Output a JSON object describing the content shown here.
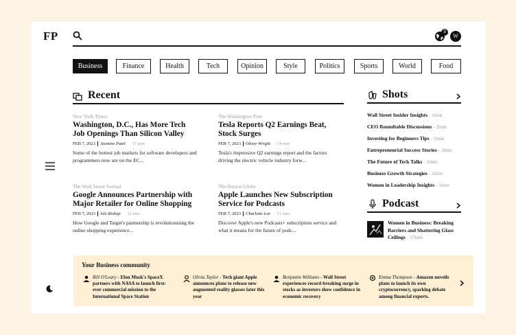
{
  "header": {
    "logo": "FP",
    "notification_count": "3",
    "avatar_initial": "W"
  },
  "categories": [
    "Business",
    "Finance",
    "Health",
    "Tech",
    "Opinion",
    "Style",
    "Politics",
    "Sports",
    "World",
    "Food"
  ],
  "active_category": "Business",
  "recent": {
    "title": "Recent",
    "articles": [
      {
        "source": "New York Times",
        "headline": "Washington, D.C., Has More Tech Job Openings Than Silicon Valley",
        "date": "FEB 7, 2023",
        "author": "Jasmine Patel",
        "read": "17 min",
        "excerpt": "Some of the hottest job markets for software developers and programmers now are on the EC..."
      },
      {
        "source": "The Washington Post",
        "headline": "Tesla Reports Q2 Earnings Beat, Stock Surges",
        "date": "FEB 7, 2023",
        "author": "Oliver Wright",
        "read": "14 min",
        "excerpt": "Tesla's impressive Q2 earnings report and the factors driving the electric vehicle industry forw..."
      },
      {
        "source": "The Wall Street Journal",
        "headline": "Google Announces Partnership with Major Retailer for Online Shopping",
        "date": "FEB 7, 2023",
        "author": "Isla Bishop",
        "read": "12 min",
        "excerpt": "How Google and Target's partnership is revolutionising the online shopping experience..."
      },
      {
        "source": "The Boston Globe",
        "headline": "Apple Launches New Subscription Service for Podcasts",
        "date": "FEB 7, 2023",
        "author": "Charlotte Lee",
        "read": "11 min",
        "excerpt": "Discover Apple's new Podcasts+ subscription service and what it means for the future of podc..."
      }
    ]
  },
  "shots": {
    "title": "Shots",
    "items": [
      {
        "title": "Wall Street Insider Insights",
        "time": "1min"
      },
      {
        "title": "CEO Roundtable Discussions",
        "time": "2min"
      },
      {
        "title": "Investing for Beginners Tips",
        "time": "1min"
      },
      {
        "title": "Entrepreneurial Success Stories",
        "time": "3min"
      },
      {
        "title": "The Future of Tech Talks",
        "time": "2min"
      },
      {
        "title": "Business Growth Strategies",
        "time": "1min"
      },
      {
        "title": "Women in Leadership Insights",
        "time": "1min"
      }
    ]
  },
  "podcast": {
    "title": "Podcast",
    "item": {
      "title": "Women in Business: Breaking Barriers and Shattering Glass Ceilings",
      "time": "37min"
    }
  },
  "community": {
    "title": "Your Business community",
    "posts": [
      {
        "name": "Bill O'Leary",
        "text": "Elon Musk's SpaceX partners with NASA to launch first-ever commercial mission to the International Space Station"
      },
      {
        "name": "Olivia Taylor",
        "text": "Tech giant Apple announces plans to release new augmented reality glasses later this year"
      },
      {
        "name": "Benjamin Williams",
        "text": "Wall Street experiences record-breaking surge in stocks as investors show confidence in economic recovery"
      },
      {
        "name": "Emma Thompson",
        "text": "Amazon unveils plans to launch its own cryptocurrency, sparking debate among financial experts."
      }
    ]
  },
  "separators": {
    "dash": " - "
  },
  "icons": [
    "search-icon",
    "globe-icon",
    "menu-icon",
    "moon-icon",
    "recent-icon",
    "shots-icon",
    "microphone-icon",
    "chevron-right-icon",
    "user-icon"
  ],
  "colors": {
    "background": "#fdf3e4",
    "card": "#ffffff",
    "community_bg": "#fdf0d5",
    "ink": "#111111",
    "muted": "#9a9a9a"
  }
}
